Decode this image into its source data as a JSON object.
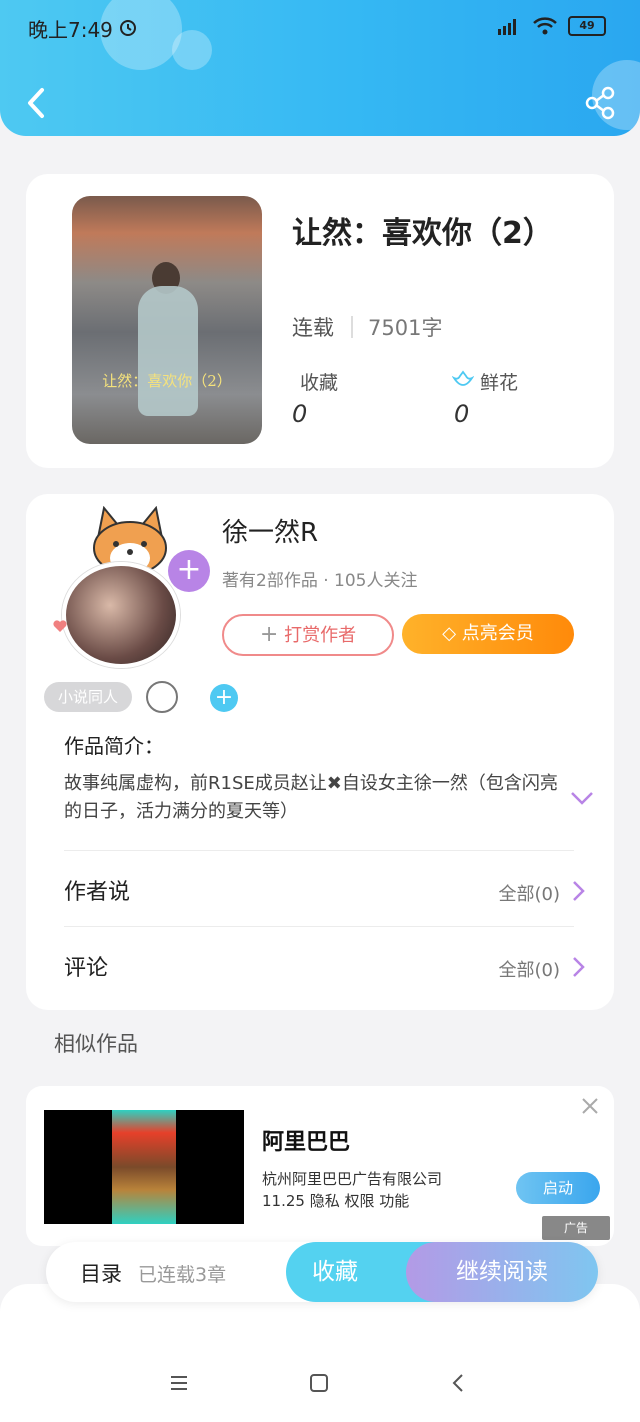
{
  "status_bar": {
    "time": "晚上7:49",
    "battery": "49"
  },
  "book": {
    "title": "让然：喜欢你（2）",
    "cover_text": "让然：喜欢你（2）",
    "status": "连载",
    "word_count": "7501字",
    "favorites_label": "收藏",
    "favorites_value": "0",
    "flowers_label": "鲜花",
    "flowers_value": "0"
  },
  "author": {
    "name": "徐一然R",
    "meta": "著有2部作品 · 105人关注",
    "tip_label": "打赏作者",
    "vip_label": "点亮会员",
    "tag": "小说同人",
    "intro_title": "作品简介：",
    "intro_text": "故事纯属虚构，前R1SE成员赵让✖自设女主徐一然（包含闪亮的日子，活力满分的夏天等）",
    "author_says_label": "作者说",
    "author_says_count": "全部(0)",
    "comments_label": "评论",
    "comments_count": "全部(0)"
  },
  "similar_title": "相似作品",
  "ad": {
    "title": "阿里巴巴",
    "company": "杭州阿里巴巴广告有限公司",
    "info": "11.25  隐私  权限  功能",
    "launch_label": "启动",
    "badge": "广告"
  },
  "bottom_bar": {
    "toc_label": "目录",
    "toc_count": "已连载3章",
    "fav_label": "收藏",
    "read_label": "继续阅读"
  },
  "colors": {
    "header": "#35b8f3",
    "accent_purple": "#b884e6",
    "vip_orange": "#ff9a14"
  }
}
